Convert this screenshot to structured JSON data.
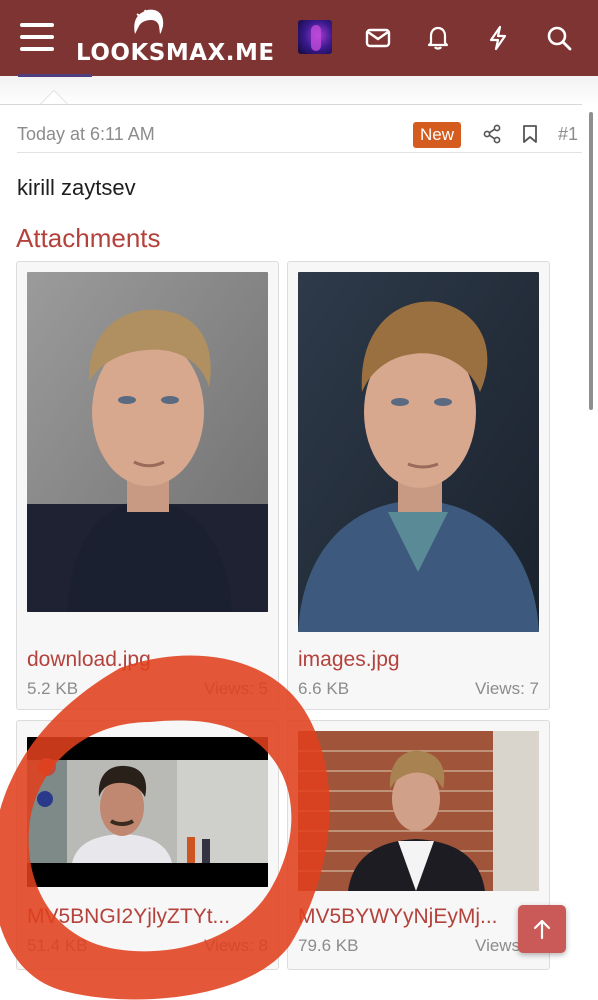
{
  "header": {
    "site_name": "LOOKSMAX.ME",
    "icons": [
      "menu-icon",
      "avatar",
      "mail-icon",
      "bell-icon",
      "bolt-icon",
      "search-icon"
    ]
  },
  "post": {
    "date": "Today at 6:11 AM",
    "badge": "New",
    "number": "#1",
    "body": "kirill zaytsev"
  },
  "attachments": {
    "heading": "Attachments",
    "items": [
      {
        "name": "download.jpg",
        "size": "5.2 KB",
        "views": "Views: 5"
      },
      {
        "name": "images.jpg",
        "size": "6.6 KB",
        "views": "Views: 7"
      },
      {
        "name": "MV5BNGI2YjlyZTYt...",
        "size": "51.4 KB",
        "views": "Views: 8"
      },
      {
        "name": "MV5BYWYyNjEyMj...",
        "size": "79.6 KB",
        "views": "Views: 8"
      }
    ]
  },
  "colors": {
    "header": "#7e3432",
    "accent": "#b4423c",
    "badge": "#d45c1e",
    "annotation": "#e0401c"
  }
}
